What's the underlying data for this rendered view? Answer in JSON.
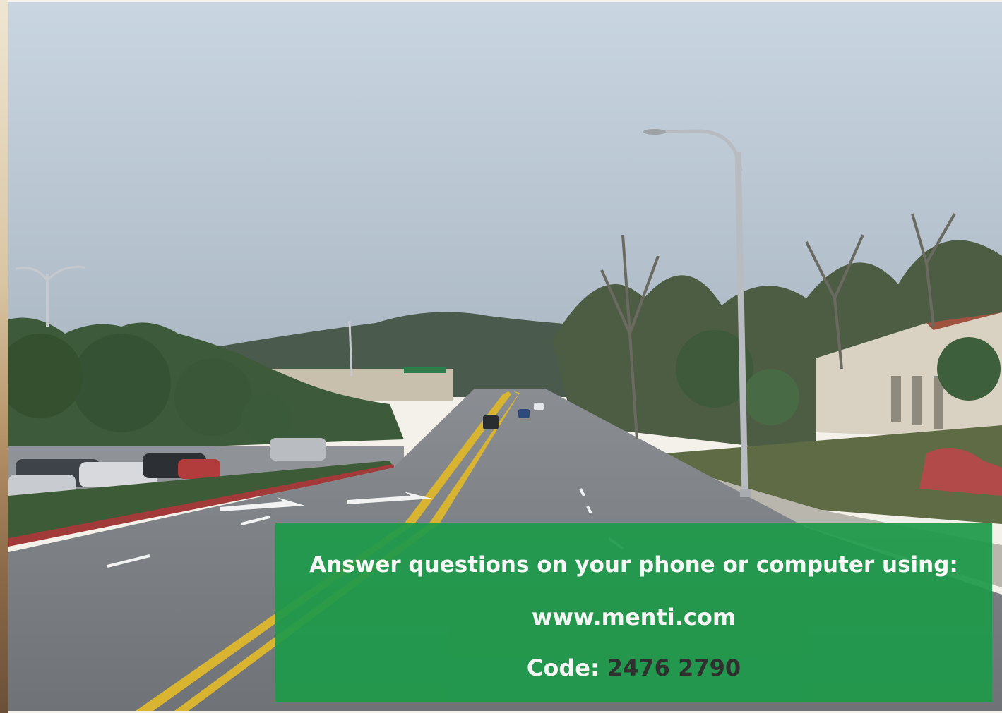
{
  "slide": {
    "background_photo": "street-scene-photo",
    "panel": {
      "instruction": "Answer questions on your phone or computer using:",
      "url": "www.menti.com",
      "code_label": "Code:",
      "code_value": "2476 2790",
      "panel_color": "#1e9a4a",
      "code_color": "#2b2b2b"
    }
  }
}
